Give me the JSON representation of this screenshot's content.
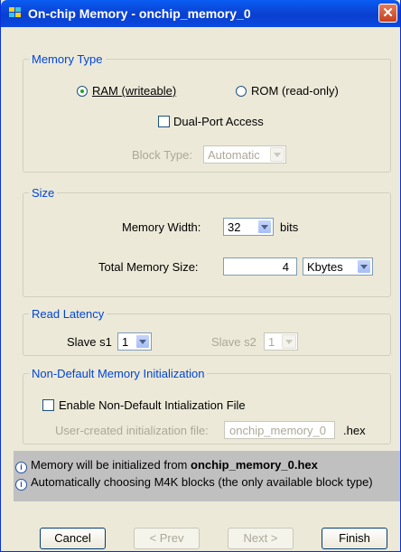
{
  "window": {
    "title": "On-chip Memory - onchip_memory_0",
    "close_glyph": "✕"
  },
  "memory_type": {
    "legend": "Memory Type",
    "ram_label": "RAM (writeable)",
    "rom_label": "ROM (read-only)",
    "selected": "ram",
    "dual_port_label": "Dual-Port Access",
    "dual_port_checked": false,
    "block_type_label": "Block Type:",
    "block_type_value": "Automatic"
  },
  "size": {
    "legend": "Size",
    "width_label": "Memory Width:",
    "width_value": "32",
    "width_unit": "bits",
    "total_label": "Total Memory Size:",
    "total_value": "4",
    "total_unit": "Kbytes"
  },
  "read_latency": {
    "legend": "Read Latency",
    "s1_label": "Slave s1",
    "s1_value": "1",
    "s2_label": "Slave s2",
    "s2_value": "1"
  },
  "init": {
    "legend": "Non-Default Memory Initialization",
    "enable_label": "Enable Non-Default Intialization File",
    "enable_checked": false,
    "file_label": "User-created initialization file:",
    "file_value": "onchip_memory_0",
    "file_ext": ".hex"
  },
  "messages": [
    {
      "icon": "info-icon",
      "prefix": "Memory will be initialized from ",
      "bold": "onchip_memory_0.hex"
    },
    {
      "icon": "info-icon",
      "text": "Automatically choosing M4K blocks (the only available block type)"
    }
  ],
  "buttons": {
    "cancel": "Cancel",
    "prev": "< Prev",
    "next": "Next >",
    "finish": "Finish"
  },
  "colors": {
    "titlebar": "#0a49e0",
    "legend": "#0046d5",
    "dialog_bg": "#ece9d8",
    "message_panel": "#c0c0c0"
  }
}
